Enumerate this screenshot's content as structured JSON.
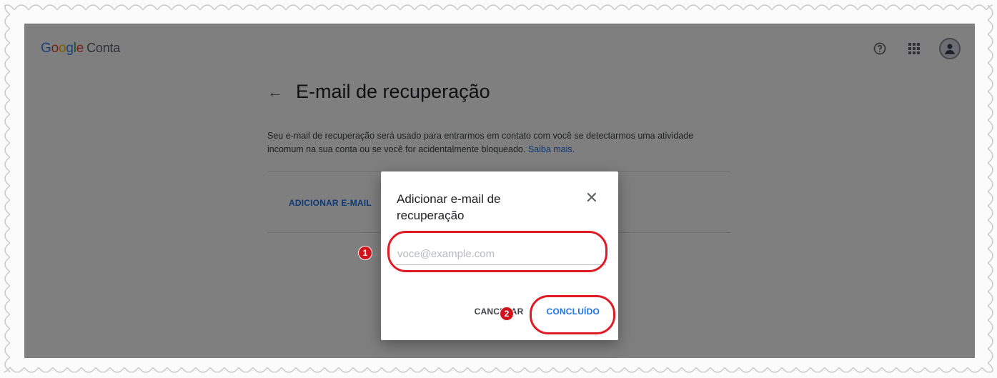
{
  "header": {
    "logo_google": [
      "G",
      "o",
      "o",
      "g",
      "l",
      "e"
    ],
    "logo_product": "Conta",
    "icons": [
      "help-icon",
      "apps-grid-icon",
      "account-avatar"
    ]
  },
  "page": {
    "title": "E-mail de recuperação",
    "description": "Seu e-mail de recuperação será usado para entrarmos em contato com você se detectarmos uma atividade incomum na sua conta ou se você for acidentalmente bloqueado.",
    "learn_more": "Saiba mais.",
    "add_button": "ADICIONAR E-MAIL"
  },
  "dialog": {
    "title": "Adicionar e-mail de recuperação",
    "input_placeholder": "voce@example.com",
    "input_value": "",
    "cancel_label": "CANCELAR",
    "done_label": "CONCLUÍDO"
  },
  "annotations": {
    "step1": "1",
    "step2": "2",
    "ring_color": "#e01b24"
  }
}
